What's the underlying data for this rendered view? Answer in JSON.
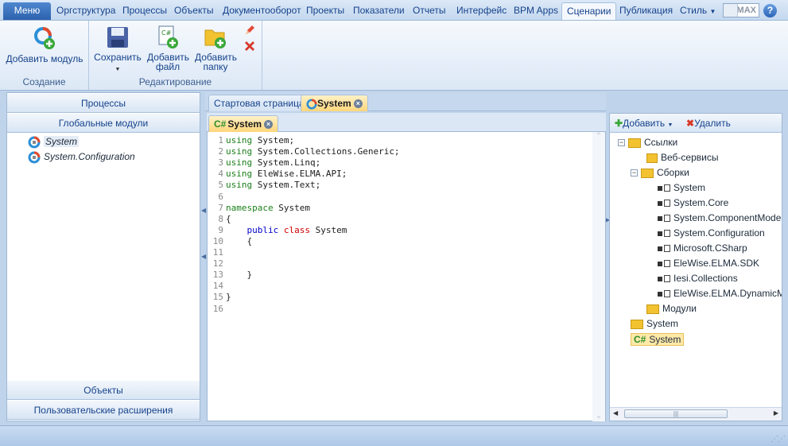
{
  "menubar": {
    "items": [
      "Меню",
      "Оргструктура",
      "Процессы",
      "Объекты",
      "Документооборот",
      "Проекты",
      "Показатели",
      "Отчеты",
      "Интерфейс",
      "BPM Apps",
      "Сценарии",
      "Публикация",
      "Стиль"
    ],
    "max_label": "MAX",
    "help_label": "?"
  },
  "ribbon": {
    "groups": [
      {
        "label": "Создание",
        "buttons": [
          {
            "label": "Добавить модуль"
          }
        ]
      },
      {
        "label": "Редактирование",
        "buttons": [
          {
            "label": "Сохранить"
          },
          {
            "label": "Добавить файл"
          },
          {
            "label": "Добавить папку"
          }
        ]
      }
    ],
    "csharp_glyph": "C#"
  },
  "left_panel": {
    "headers_top": [
      "Процессы",
      "Глобальные модули"
    ],
    "headers_bottom": [
      "Объекты",
      "Пользовательские расширения"
    ],
    "modules": [
      "System",
      "System.Configuration"
    ]
  },
  "center": {
    "doc_tabs": [
      "Стартовая страница",
      "System"
    ],
    "sub_tab": "System",
    "code_lines": [
      {
        "n": "1",
        "parts": [
          [
            "kw",
            "using"
          ],
          [
            "",
            "System;"
          ]
        ]
      },
      {
        "n": "2",
        "parts": [
          [
            "kw",
            "using"
          ],
          [
            "",
            "System.Collections.Generic;"
          ]
        ]
      },
      {
        "n": "3",
        "parts": [
          [
            "kw",
            "using"
          ],
          [
            "",
            "System.Linq;"
          ]
        ]
      },
      {
        "n": "4",
        "parts": [
          [
            "kw",
            "using"
          ],
          [
            "",
            "EleWise.ELMA.API;"
          ]
        ]
      },
      {
        "n": "5",
        "parts": [
          [
            "kw",
            "using"
          ],
          [
            "",
            "System.Text;"
          ]
        ]
      },
      {
        "n": "6",
        "parts": []
      },
      {
        "n": "7",
        "parts": [
          [
            "kw",
            "namespace"
          ],
          [
            "",
            "System"
          ]
        ]
      },
      {
        "n": "8",
        "parts": [
          [
            "",
            "{"
          ]
        ]
      },
      {
        "n": "9",
        "parts": [
          [
            "",
            "    "
          ],
          [
            "kw2",
            "public"
          ],
          [
            "kw3",
            "class"
          ],
          [
            "",
            "System"
          ]
        ]
      },
      {
        "n": "10",
        "parts": [
          [
            "",
            "    {"
          ]
        ]
      },
      {
        "n": "11",
        "parts": []
      },
      {
        "n": "12",
        "parts": []
      },
      {
        "n": "13",
        "parts": [
          [
            "",
            "    }"
          ]
        ]
      },
      {
        "n": "14",
        "parts": []
      },
      {
        "n": "15",
        "parts": [
          [
            "",
            "}"
          ]
        ]
      },
      {
        "n": "16",
        "parts": []
      }
    ]
  },
  "right_panel": {
    "add_label": "Добавить",
    "delete_label": "Удалить",
    "tree": {
      "links": "Ссылки",
      "web_services": "Веб-сервисы",
      "assemblies": "Сборки",
      "assembly_items": [
        "System",
        "System.Core",
        "System.ComponentModel.D",
        "System.Configuration",
        "Microsoft.CSharp",
        "EleWise.ELMA.SDK",
        "Iesi.Collections",
        "EleWise.ELMA.DynamicMo"
      ],
      "modules": "Модули",
      "folder_system": "System",
      "file_system": "System"
    }
  },
  "colors": {
    "accent": "#2c62ad",
    "highlight": "#ffd67a",
    "keyword": "#1a7f1a",
    "keyword_blue": "#0000cc",
    "keyword_red": "#d00000"
  }
}
